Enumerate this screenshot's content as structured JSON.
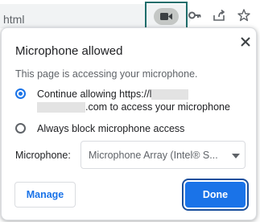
{
  "omnibox": {
    "url_fragment": "html",
    "icons": [
      "camera-icon",
      "key-icon",
      "share-icon",
      "star-icon"
    ]
  },
  "bubble": {
    "title": "Microphone allowed",
    "description": "This page is accessing your microphone.",
    "options": [
      {
        "label_prefix": "Continue allowing https://l",
        "label_suffix": ".com to access your microphone",
        "checked": true
      },
      {
        "label": "Always block microphone access",
        "checked": false
      }
    ],
    "mic_label": "Microphone:",
    "mic_selected": "Microphone Array (Intel® S...",
    "manage_label": "Manage",
    "done_label": "Done"
  },
  "colors": {
    "accent": "#1a73e8",
    "highlight_border": "#1e6d6b",
    "chip_bg": "#c4c7c5"
  }
}
